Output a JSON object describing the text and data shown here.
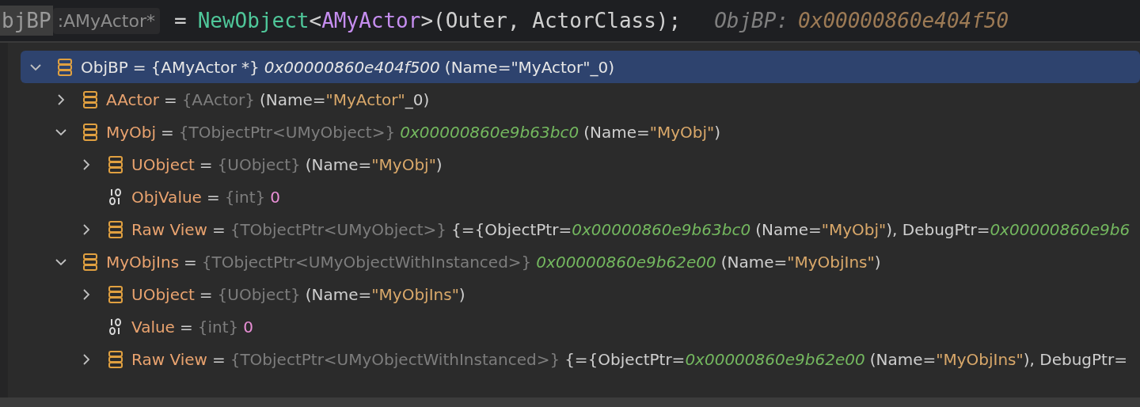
{
  "code_line": [
    {
      "kind": "ident",
      "text": "bjBP"
    },
    {
      "kind": "inlay",
      "text": ":AMyActor*"
    },
    {
      "kind": "plain",
      "text": "="
    },
    {
      "kind": "func",
      "text": "NewObject"
    },
    {
      "kind": "punct",
      "text": "<"
    },
    {
      "kind": "type",
      "text": "AMyActor"
    },
    {
      "kind": "punct",
      "text": ">(Outer, ActorClass);"
    },
    {
      "kind": "debug_label",
      "text": "ObjBP:"
    },
    {
      "kind": "debug_value",
      "text": "0x00000860e404f50"
    }
  ],
  "variables": [
    {
      "name": "ObjBP",
      "separator": "=",
      "type": "{AMyActor *}",
      "kind": "struct",
      "expanded": true,
      "selected": true,
      "value": [
        {
          "kind": "addr",
          "text": "0x00000860e404f500"
        },
        {
          "kind": "plain",
          "text": "(Name="
        },
        {
          "kind": "str",
          "text": "\"MyActor\""
        },
        {
          "kind": "plain",
          "text": "_0)"
        }
      ],
      "children": [
        {
          "name": "AActor",
          "separator": "=",
          "type": "{AActor}",
          "kind": "struct",
          "expanded": false,
          "selected": false,
          "value": [
            {
              "kind": "plain",
              "text": "(Name="
            },
            {
              "kind": "str",
              "text": "\"MyActor\""
            },
            {
              "kind": "plain",
              "text": "_0)"
            }
          ]
        },
        {
          "name": "MyObj",
          "separator": "=",
          "type": "{TObjectPtr<UMyObject>}",
          "kind": "struct",
          "expanded": true,
          "selected": false,
          "value": [
            {
              "kind": "addr",
              "text": "0x00000860e9b63bc0"
            },
            {
              "kind": "plain",
              "text": "(Name="
            },
            {
              "kind": "str",
              "text": "\"MyObj\""
            },
            {
              "kind": "plain",
              "text": ")"
            }
          ],
          "children": [
            {
              "name": "UObject",
              "separator": "=",
              "type": "{UObject}",
              "kind": "struct",
              "expanded": false,
              "selected": false,
              "value": [
                {
                  "kind": "plain",
                  "text": "(Name="
                },
                {
                  "kind": "str",
                  "text": "\"MyObj\""
                },
                {
                  "kind": "plain",
                  "text": ")"
                }
              ]
            },
            {
              "name": "ObjValue",
              "separator": "=",
              "type": "{int}",
              "kind": "int",
              "selected": false,
              "value": [
                {
                  "kind": "num",
                  "text": "0"
                }
              ]
            },
            {
              "name": "Raw View",
              "separator": "=",
              "type": "{TObjectPtr<UMyObject>}",
              "kind": "struct",
              "expanded": false,
              "selected": false,
              "value": [
                {
                  "kind": "plain",
                  "text": "{={ObjectPtr="
                },
                {
                  "kind": "addr",
                  "text": "0x00000860e9b63bc0"
                },
                {
                  "kind": "plain",
                  "text": "(Name="
                },
                {
                  "kind": "str",
                  "text": "\"MyObj\""
                },
                {
                  "kind": "plain",
                  "text": "), DebugPtr="
                },
                {
                  "kind": "addr",
                  "text": "0x00000860e9b6"
                }
              ]
            }
          ]
        },
        {
          "name": "MyObjIns",
          "separator": "=",
          "type": "{TObjectPtr<UMyObjectWithInstanced>}",
          "kind": "struct",
          "expanded": true,
          "selected": false,
          "value": [
            {
              "kind": "addr",
              "text": "0x00000860e9b62e00"
            },
            {
              "kind": "plain",
              "text": "(Name="
            },
            {
              "kind": "str",
              "text": "\"MyObjIns\""
            },
            {
              "kind": "plain",
              "text": ")"
            }
          ],
          "children": [
            {
              "name": "UObject",
              "separator": "=",
              "type": "{UObject}",
              "kind": "struct",
              "expanded": false,
              "selected": false,
              "value": [
                {
                  "kind": "plain",
                  "text": "(Name="
                },
                {
                  "kind": "str",
                  "text": "\"MyObjIns\""
                },
                {
                  "kind": "plain",
                  "text": ")"
                }
              ]
            },
            {
              "name": "Value",
              "separator": "=",
              "type": "{int}",
              "kind": "int",
              "selected": false,
              "value": [
                {
                  "kind": "num",
                  "text": "0"
                }
              ]
            },
            {
              "name": "Raw View",
              "separator": "=",
              "type": "{TObjectPtr<UMyObjectWithInstanced>}",
              "kind": "struct",
              "expanded": false,
              "selected": false,
              "value": [
                {
                  "kind": "plain",
                  "text": "{={ObjectPtr="
                },
                {
                  "kind": "addr",
                  "text": "0x00000860e9b62e00"
                },
                {
                  "kind": "plain",
                  "text": "(Name="
                },
                {
                  "kind": "str",
                  "text": "\"MyObjIns\""
                },
                {
                  "kind": "plain",
                  "text": "), DebugPtr="
                }
              ]
            }
          ]
        }
      ]
    }
  ]
}
